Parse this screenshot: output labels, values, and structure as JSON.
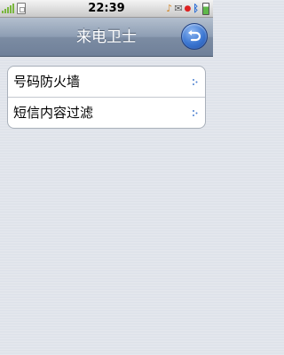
{
  "status_bar": {
    "time": "22:39",
    "icons": [
      "signal-icon",
      "sim-card-icon",
      "music-note-icon",
      "mail-icon",
      "bluetooth-icon",
      "battery-icon"
    ]
  },
  "header": {
    "title": "来电卫士",
    "back_icon": "back-arrow-icon"
  },
  "menu": {
    "items": [
      {
        "label": "号码防火墙",
        "icon": "chevron-right-icon"
      },
      {
        "label": "短信内容过滤",
        "icon": "chevron-right-icon"
      }
    ]
  },
  "colors": {
    "title_bar": "#8d9db3",
    "back_button": "#3b76d1",
    "background": "#dfe3ea"
  }
}
